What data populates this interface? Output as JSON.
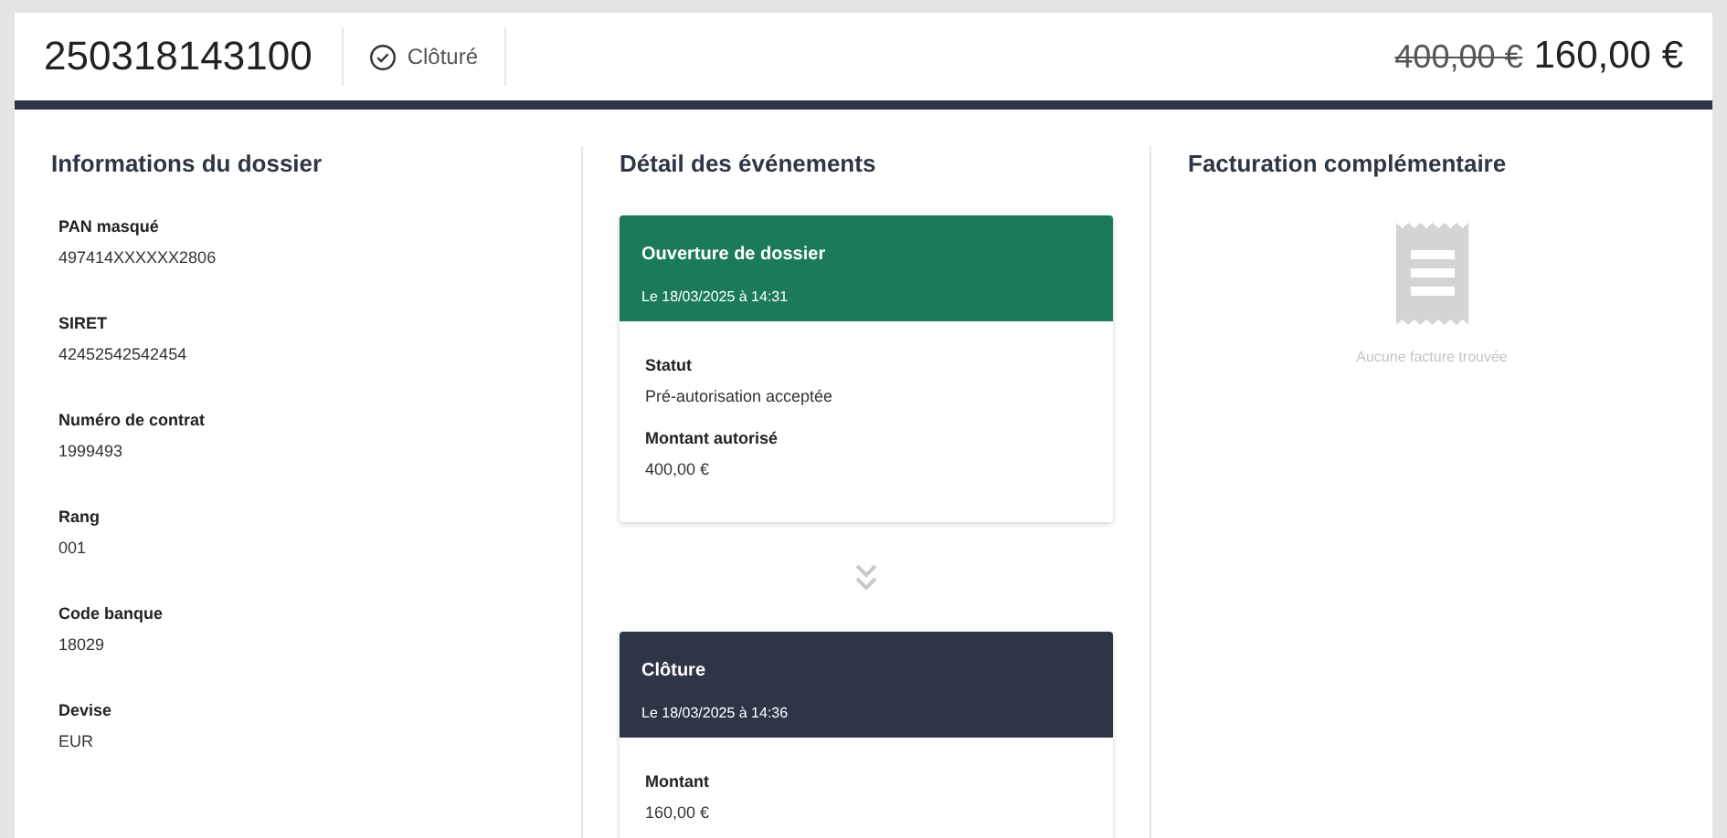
{
  "header": {
    "reference": "250318143100",
    "status": "Clôturé",
    "original_amount": "400,00 €",
    "amount": "160,00 €"
  },
  "info": {
    "title": "Informations du dossier",
    "fields": [
      {
        "label": "PAN masqué",
        "value": "497414XXXXXX2806"
      },
      {
        "label": "SIRET",
        "value": "42452542542454"
      },
      {
        "label": "Numéro de contrat",
        "value": "1999493"
      },
      {
        "label": "Rang",
        "value": "001"
      },
      {
        "label": "Code banque",
        "value": "18029"
      },
      {
        "label": "Devise",
        "value": "EUR"
      }
    ]
  },
  "events": {
    "title": "Détail des événements",
    "items": [
      {
        "kind": "opening",
        "title": "Ouverture de dossier",
        "date": "Le 18/03/2025 à 14:31",
        "fields": [
          {
            "label": "Statut",
            "value": "Pré-autorisation acceptée"
          },
          {
            "label": "Montant autorisé",
            "value": "400,00 €"
          }
        ]
      },
      {
        "kind": "closing",
        "title": "Clôture",
        "date": "Le 18/03/2025 à 14:36",
        "fields": [
          {
            "label": "Montant",
            "value": "160,00 €"
          }
        ]
      }
    ]
  },
  "billing": {
    "title": "Facturation complémentaire",
    "empty_message": "Aucune facture trouvée"
  }
}
